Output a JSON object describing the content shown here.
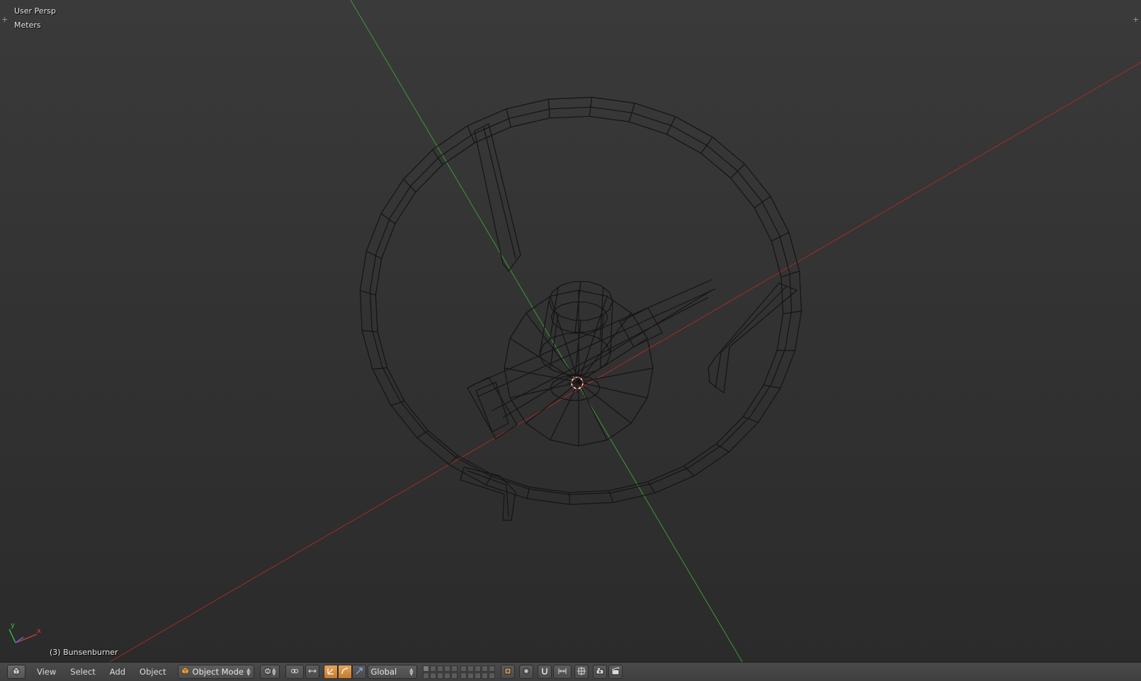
{
  "viewport": {
    "view_name": "User Persp",
    "units": "Meters",
    "active_object": "(3) Bunsenburner",
    "axis_gizmo": {
      "x_label": "x",
      "y_label": "y"
    }
  },
  "header": {
    "editor_type_icon": "3d-view-icon",
    "menus": {
      "view": "View",
      "select": "Select",
      "add": "Add",
      "object": "Object"
    },
    "mode": {
      "label": "Object Mode",
      "icon": "cube-icon"
    },
    "pivot_icon": "pivot-point-icon",
    "transform_orientation": "Global"
  },
  "colors": {
    "viewport_bg_top": "#3a3a3a",
    "viewport_bg_bottom": "#2b2b2b",
    "x_axis": "#a52a2a",
    "y_axis": "#3a9a3a",
    "wireframe": "#141414",
    "active_tool": "#d48b3e"
  }
}
